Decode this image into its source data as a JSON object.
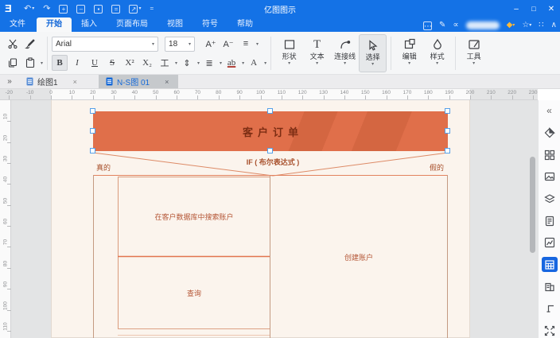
{
  "titlebar": {
    "title": "亿图图示",
    "quick_icons": [
      {
        "name": "undo",
        "glyph": "↶"
      },
      {
        "name": "redo",
        "glyph": "↷"
      },
      {
        "name": "new-document",
        "glyph": "+"
      },
      {
        "name": "print",
        "glyph": "–"
      },
      {
        "name": "save",
        "glyph": "▪"
      },
      {
        "name": "mail",
        "glyph": "="
      },
      {
        "name": "export",
        "glyph": "↗"
      },
      {
        "name": "customize-quick-access",
        "glyph": "="
      }
    ],
    "controls": {
      "minimize": "–",
      "maximize": "□",
      "close": "✕"
    }
  },
  "menubar": {
    "items": [
      "文件",
      "开始",
      "插入",
      "页面布局",
      "视图",
      "符号",
      "帮助"
    ],
    "active_item": "开始",
    "right_icons": [
      {
        "name": "feedback",
        "glyph": "⋯"
      },
      {
        "name": "pen-pointer",
        "glyph": "✎"
      },
      {
        "name": "share",
        "glyph": "∝"
      },
      {
        "name": "vip-diamond",
        "glyph": "◆"
      },
      {
        "name": "favorite-star",
        "glyph": "☆"
      },
      {
        "name": "apps-grid",
        "glyph": "∷"
      },
      {
        "name": "collapse-ribbon",
        "glyph": "∧"
      }
    ]
  },
  "toolbar": {
    "font_name": "Arial",
    "font_size": "18",
    "format_buttons": [
      "B",
      "I",
      "U",
      "S",
      "X²",
      "X₂",
      "工",
      "ab",
      "A"
    ],
    "grow_font": "A⁺",
    "shrink_font": "A⁻",
    "tool_buttons": [
      "形状",
      "文本",
      "连接线",
      "选择",
      "编辑",
      "样式",
      "工具"
    ],
    "active_tool": "选择"
  },
  "tabs": [
    {
      "label": "绘图1",
      "close": "×",
      "active": false
    },
    {
      "label": "N-S图 01",
      "close": "×",
      "active": true
    }
  ],
  "tab_expander": "»",
  "ruler": {
    "h_numbers": [
      -20,
      -10,
      0,
      10,
      20,
      30,
      40,
      50,
      60,
      70,
      80,
      90,
      100,
      110,
      120,
      130,
      140,
      150,
      160,
      170,
      180,
      190,
      200,
      210,
      220,
      230
    ],
    "v_numbers": [
      10,
      20,
      30,
      40,
      50,
      60,
      70,
      80,
      90,
      100,
      110
    ]
  },
  "diagram": {
    "title": "客户订单",
    "condition": "IF ( 布尔表达式 )",
    "branch_true": "真的",
    "branch_false": "假的",
    "cell_search": "在客户数据库中搜索账户",
    "cell_query": "查询",
    "cell_create": "创建账户"
  },
  "sidebar": {
    "icons": [
      "collapse-panel",
      "fill-style",
      "symbol-library",
      "image",
      "layers",
      "page-setup",
      "chart",
      "table",
      "org-building",
      "connector",
      "fit-view"
    ],
    "selected": "table"
  },
  "colors": {
    "titlebar_blue": "#1472e6",
    "banner_orange": "#e06f4a",
    "banner_text": "#7c2d13",
    "line_salmon": "#e2825f",
    "line_tan": "#c49a82",
    "accent_blue": "#1766e0"
  }
}
